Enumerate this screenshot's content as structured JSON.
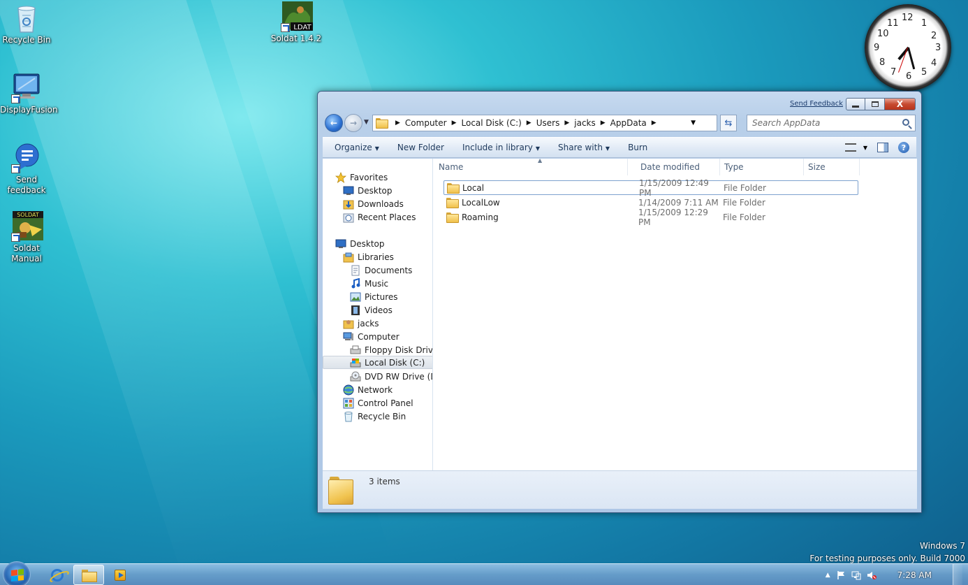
{
  "desktop": {
    "icons": {
      "recycle_bin": "Recycle Bin",
      "display_fusion": "DisplayFusion",
      "send_feedback": "Send feedback",
      "soldat_manual": "Soldat Manual",
      "soldat": "Soldat 1.4.2",
      "soldat_badge": "LDAT",
      "soldat_manual_badge": "SOLDAT"
    },
    "watermark": {
      "line1": "Windows 7",
      "line2": "For testing purposes only. Build 7000"
    }
  },
  "clock_gadget": {
    "numerals": [
      "12",
      "1",
      "2",
      "3",
      "4",
      "5",
      "6",
      "7",
      "8",
      "9",
      "10",
      "11"
    ]
  },
  "window": {
    "send_feedback": "Send Feedback",
    "title_buttons": {
      "minimize": "",
      "maximize": "",
      "close": "X"
    },
    "address": {
      "crumbs": [
        "Computer",
        "Local Disk (C:)",
        "Users",
        "jacks",
        "AppData"
      ]
    },
    "search_placeholder": "Search AppData",
    "toolbar": {
      "organize": "Organize",
      "new_folder": "New Folder",
      "include_in_library": "Include in library",
      "share_with": "Share with",
      "burn": "Burn"
    },
    "nav": {
      "favorites": "Favorites",
      "desktop_fav": "Desktop",
      "downloads": "Downloads",
      "recent_places": "Recent Places",
      "desktop": "Desktop",
      "libraries": "Libraries",
      "documents": "Documents",
      "music": "Music",
      "pictures": "Pictures",
      "videos": "Videos",
      "jacks": "jacks",
      "computer": "Computer",
      "floppy": "Floppy Disk Drive (",
      "local_disk": "Local Disk (C:)",
      "dvd": "DVD RW Drive (D:)",
      "network": "Network",
      "control_panel": "Control Panel",
      "recycle_bin": "Recycle Bin"
    },
    "columns": {
      "name": "Name",
      "date_modified": "Date modified",
      "type": "Type",
      "size": "Size"
    },
    "files": [
      {
        "name": "Local",
        "date": "1/15/2009 12:49 PM",
        "type": "File Folder"
      },
      {
        "name": "LocalLow",
        "date": "1/14/2009 7:11 AM",
        "type": "File Folder"
      },
      {
        "name": "Roaming",
        "date": "1/15/2009 12:29 PM",
        "type": "File Folder"
      }
    ],
    "details": {
      "count": "3 items"
    }
  },
  "taskbar": {
    "time": "7:28 AM"
  },
  "colors": {
    "accent": "#2a6fd1",
    "window_frame": "#b8cfe9",
    "close_button": "#c74a30"
  }
}
